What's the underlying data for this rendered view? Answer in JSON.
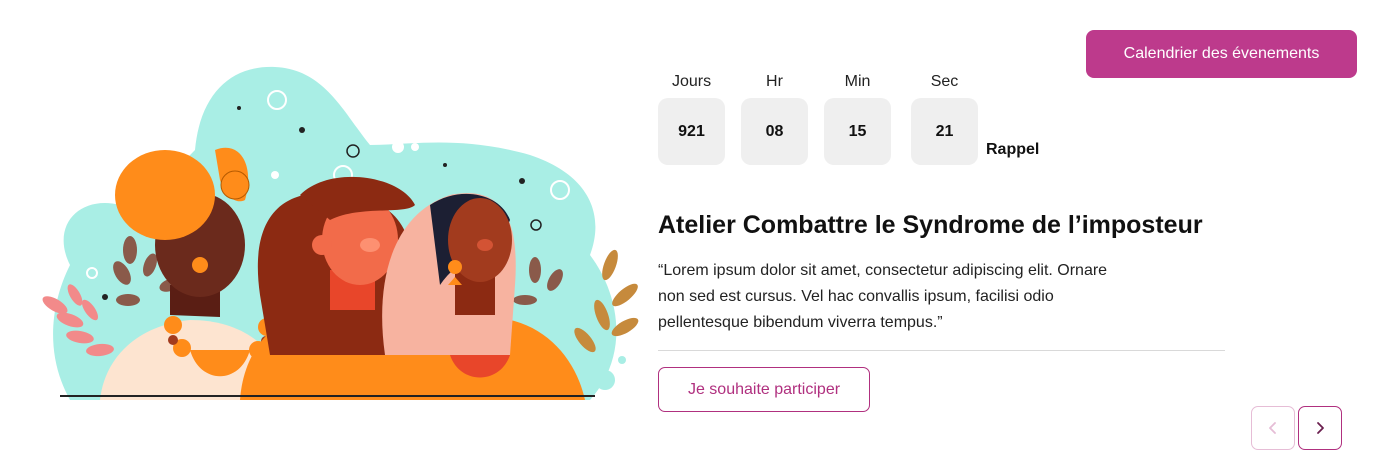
{
  "header": {
    "calendar_button_label": "Calendrier des évenements"
  },
  "countdown": {
    "units": [
      {
        "label": "Jours",
        "value": "921"
      },
      {
        "label": "Hr",
        "value": "08"
      },
      {
        "label": "Min",
        "value": "15"
      },
      {
        "label": "Sec",
        "value": "21"
      }
    ],
    "reminder_label": "Rappel"
  },
  "event": {
    "title": "Atelier Combattre le Syndrome de l’imposteur",
    "description": "“Lorem ipsum dolor sit amet, consectetur adipiscing elit. Ornare non sed est cursus. Vel hac convallis ipsum, facilisi odio pellentesque bibendum viverra tempus.”",
    "participate_label": "Je souhaite participer"
  },
  "carousel": {
    "prev_icon": "chevron-left-icon",
    "next_icon": "chevron-right-icon"
  },
  "illustration": {
    "subject": "three-women-illustration"
  },
  "colors": {
    "accent": "#bd3a8c",
    "accent_outline": "#b0307f",
    "countdown_box": "#efefef",
    "blob": "#a9eee5"
  }
}
